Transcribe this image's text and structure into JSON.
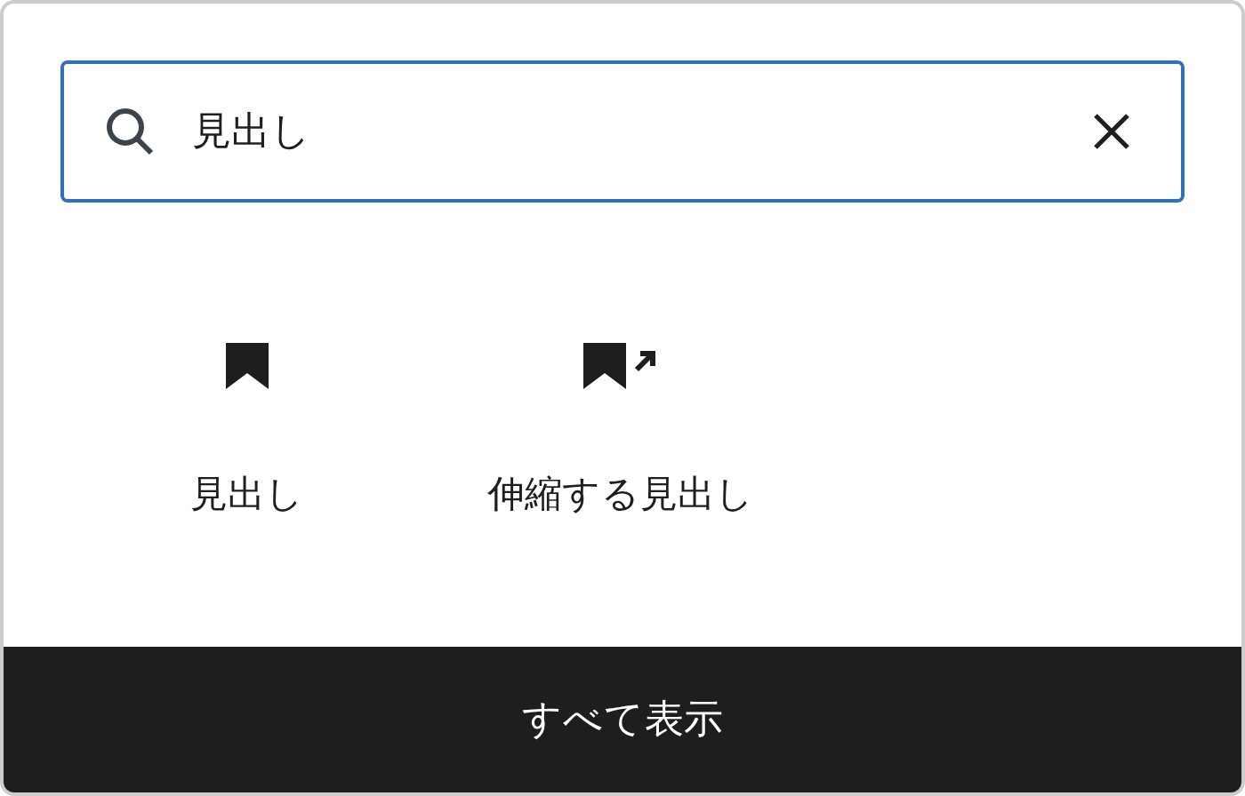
{
  "search": {
    "value": "見出し"
  },
  "results": [
    {
      "kind": "plain",
      "label": "見出し"
    },
    {
      "kind": "linked",
      "label": "伸縮する見出し"
    }
  ],
  "footer": {
    "label": "すべて表示"
  }
}
